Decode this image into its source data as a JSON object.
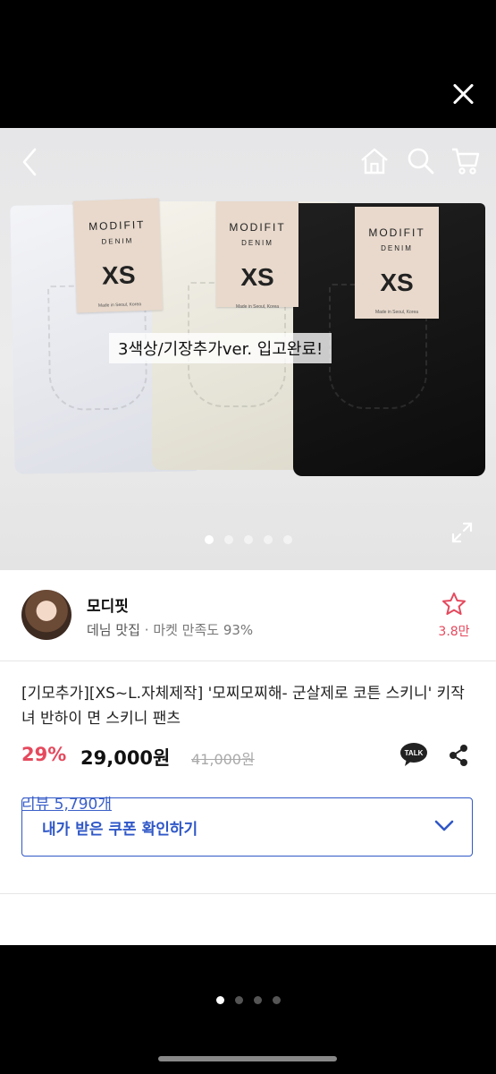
{
  "hero": {
    "caption": "3색상/기장추가ver. 입고완료!",
    "tags": [
      {
        "brand": "MODIFIT",
        "sub": "DENIM",
        "size": "XS",
        "tiny": "Made in Seoul, Korea"
      },
      {
        "brand": "MODIFIT",
        "sub": "DENIM",
        "size": "XS",
        "tiny": "Made in Seoul, Korea"
      },
      {
        "brand": "MODIFIT",
        "sub": "DENIM",
        "size": "XS",
        "tiny": "Made in Seoul, Korea"
      }
    ],
    "image_index": 1,
    "image_total": 5
  },
  "shop": {
    "name": "모디핏",
    "category": "데님 맛집",
    "separator": "·",
    "satisfaction": "마켓 만족도 93%",
    "favorite_count": "3.8만"
  },
  "product": {
    "title": "[기모추가][XS~L.자체제작] '모찌모찌해- 군살제로 코튼 스키니' 키작녀 반하이 면 스키니 팬츠",
    "discount": "29%",
    "price": "29,000원",
    "original_price": "41,000원",
    "talk_label": "TALK",
    "coupon_label": "내가 받은 쿠폰 확인하기"
  },
  "review_link": "리뷰 5,790개",
  "pager": {
    "current": 1,
    "total": 4
  },
  "colors": {
    "accent_red": "#e5495d",
    "accent_blue": "#2f57c7",
    "link_blue": "#3a5fc8"
  },
  "icons": [
    "close-icon",
    "back-icon",
    "home-icon",
    "search-icon",
    "cart-icon",
    "expand-icon",
    "star-outline-icon",
    "kakaotalk-icon",
    "share-icon",
    "chevron-down-icon"
  ]
}
